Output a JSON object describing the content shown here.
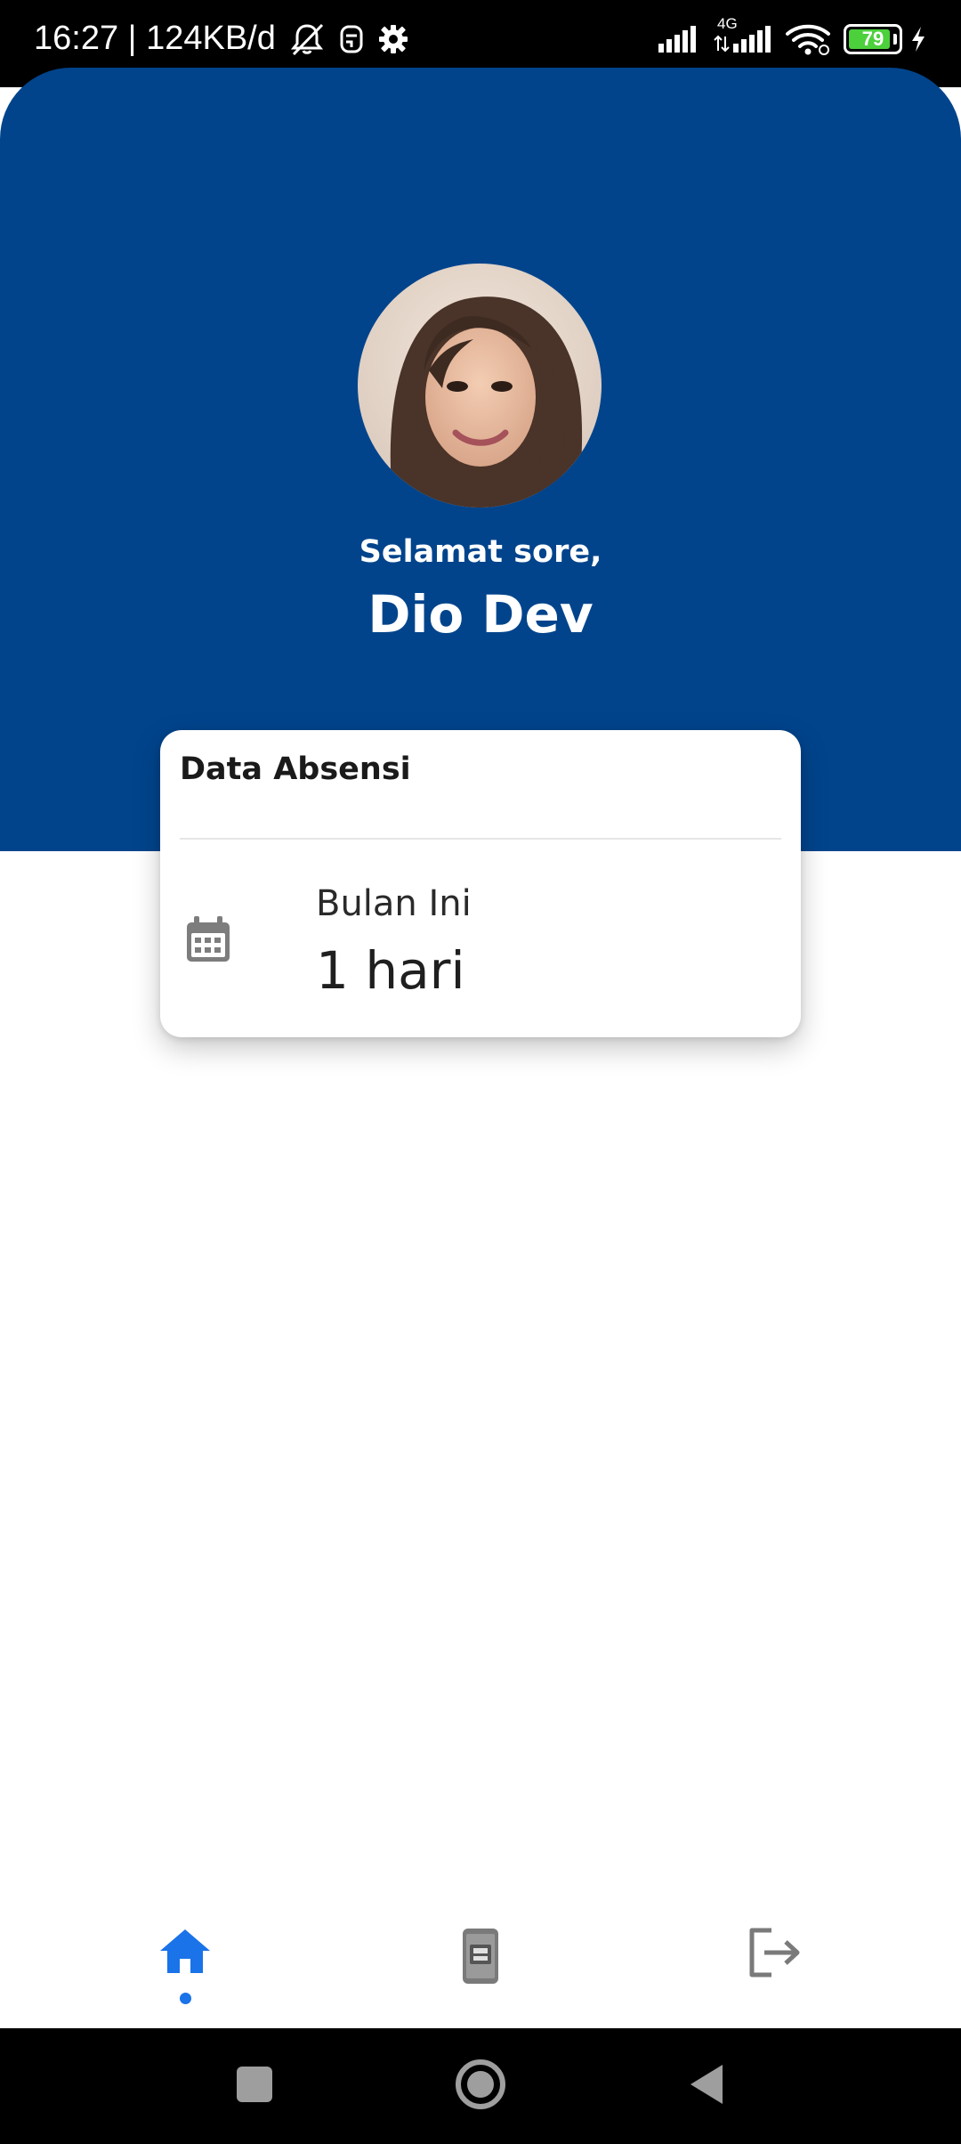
{
  "status_bar": {
    "time_text": "16:27 | 124KB/d",
    "network_type": "4G",
    "battery_level": "79",
    "icons": [
      "muted-alarm-icon",
      "app-notification-icon",
      "settings-gear-icon",
      "signal-icon",
      "signal-4g-icon",
      "wifi-icon",
      "battery-icon",
      "charging-icon"
    ]
  },
  "header": {
    "greeting": "Selamat sore,",
    "user_name": "Dio Dev",
    "background_color": "#01448c"
  },
  "attendance_card": {
    "title": "Data Absensi",
    "period_label": "Bulan Ini",
    "period_value": "1 hari",
    "icon": "calendar-icon"
  },
  "bottom_nav": {
    "items": [
      {
        "name": "home",
        "icon": "home-icon",
        "active": true
      },
      {
        "name": "attendance",
        "icon": "id-card-icon",
        "active": false
      },
      {
        "name": "logout",
        "icon": "logout-icon",
        "active": false
      }
    ],
    "active_color": "#1a73e8",
    "inactive_color": "#7a7a7a"
  },
  "system_nav": {
    "items": [
      "recent-apps-icon",
      "home-circle-icon",
      "back-icon"
    ]
  }
}
